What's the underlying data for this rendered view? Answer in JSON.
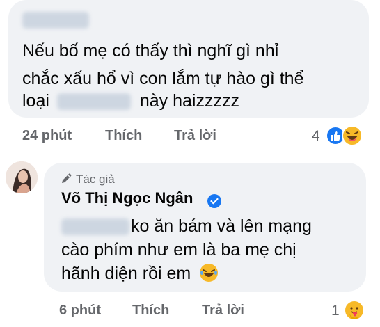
{
  "comment1": {
    "text_line1": "Nếu bố mẹ có thấy thì nghĩ gì nhỉ",
    "text_line2": "chắc xấu hổ vì con lắm tự hào gì thể",
    "text_line3_before": "loại",
    "text_line3_after": "này haizzzzz",
    "time": "24 phút",
    "like_label": "Thích",
    "reply_label": "Trả lời",
    "reaction_count": "4",
    "reaction_icons": [
      "like-reaction-icon",
      "haha-reaction-icon"
    ]
  },
  "comment2": {
    "author_badge": "Tác giả",
    "author_name": "Võ Thị Ngọc Ngân",
    "text_line1_after": "ko ăn bám và lên mạng",
    "text_line2": "cào phím như em là ba mẹ chị",
    "text_line3": "hãnh diện rồi em",
    "time": "6 phút",
    "like_label": "Thích",
    "reply_label": "Trả lời",
    "reaction_count": "1",
    "reaction_icons": [
      "care-reaction-icon"
    ]
  },
  "colors": {
    "bubble": "#f0f2f5",
    "meta_text": "#65676b",
    "like_blue": "#1877f2",
    "haha_yellow": "#f7b928"
  }
}
